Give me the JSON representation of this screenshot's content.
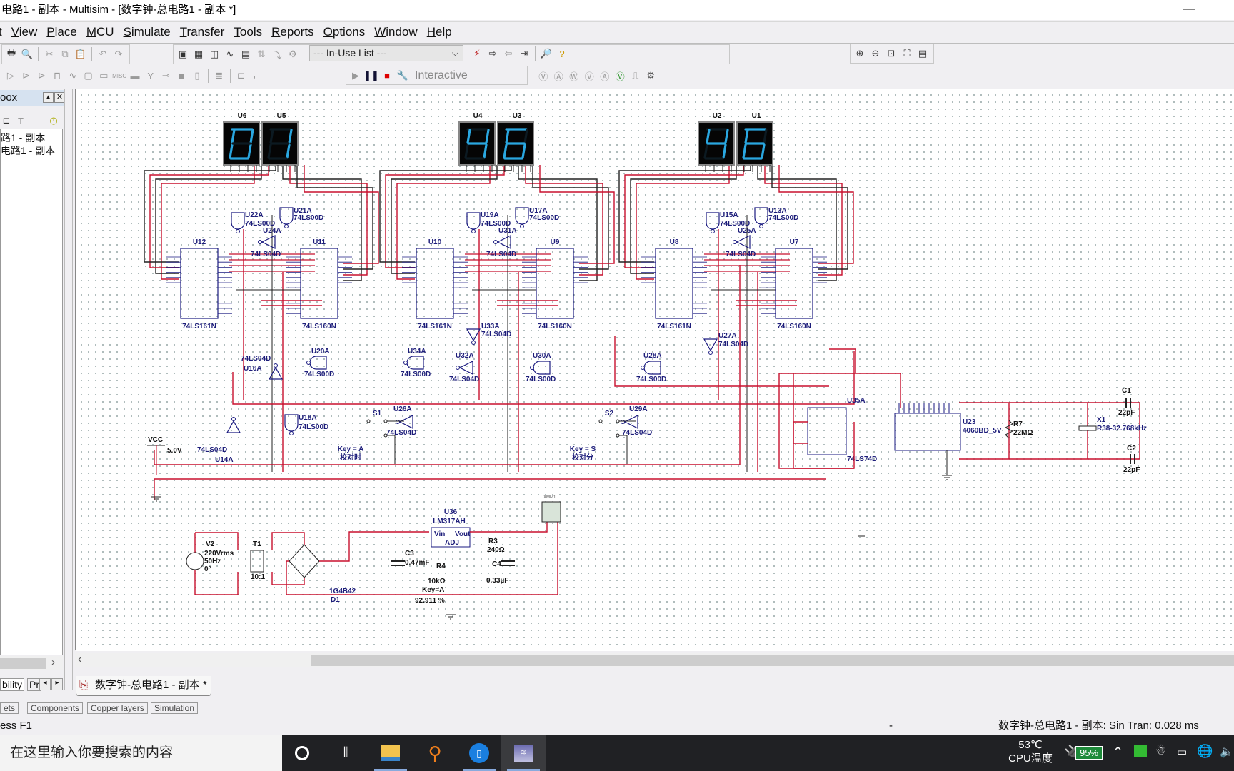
{
  "window": {
    "title": "电路1 - 副本 - Multisim - [数字钟-总电路1 - 副本 *]",
    "minimize": "—"
  },
  "menu": [
    {
      "label": "t",
      "u": ""
    },
    {
      "label": "View"
    },
    {
      "label": "Place"
    },
    {
      "label": "MCU"
    },
    {
      "label": "Simulate"
    },
    {
      "label": "Transfer"
    },
    {
      "label": "Tools"
    },
    {
      "label": "Reports"
    },
    {
      "label": "Options"
    },
    {
      "label": "Window"
    },
    {
      "label": "Help"
    }
  ],
  "toolbar": {
    "inuse_list": "--- In-Use List ---",
    "interactive_label": "Interactive",
    "zoom_icons": [
      "zoom-in",
      "zoom-out",
      "zoom-area",
      "zoom-fit",
      "full-screen"
    ],
    "instrument_icons": [
      "V",
      "A",
      "W",
      "±V",
      "AV",
      "−V",
      "Π",
      "⚙"
    ]
  },
  "sidebar": {
    "header": "oox",
    "tree": [
      "路1 - 副本",
      "电路1 - 副本"
    ],
    "tabs": [
      "bility",
      "Pr"
    ]
  },
  "schematic": {
    "displays": [
      {
        "ref": "U6",
        "digit": "0"
      },
      {
        "ref": "U5",
        "digit": "1"
      },
      {
        "ref": "U4",
        "digit": "4"
      },
      {
        "ref": "U3",
        "digit": "6"
      },
      {
        "ref": "U2",
        "digit": "4"
      },
      {
        "ref": "U1",
        "digit": "6"
      }
    ],
    "counters": [
      {
        "ref": "U12",
        "part": "74LS161N"
      },
      {
        "ref": "U11",
        "part": "74LS160N"
      },
      {
        "ref": "U10",
        "part": "74LS161N"
      },
      {
        "ref": "U9",
        "part": "74LS160N"
      },
      {
        "ref": "U8",
        "part": "74LS161N"
      },
      {
        "ref": "U7",
        "part": "74LS160N"
      }
    ],
    "gates": [
      {
        "ref": "U22A",
        "part": "74LS00D"
      },
      {
        "ref": "U21A",
        "part": "74LS00D"
      },
      {
        "ref": "U24A",
        "part": "74LS04D"
      },
      {
        "ref": "U19A",
        "part": "74LS00D"
      },
      {
        "ref": "U17A",
        "part": "74LS00D"
      },
      {
        "ref": "U31A",
        "part": "74LS04D"
      },
      {
        "ref": "U15A",
        "part": "74LS00D"
      },
      {
        "ref": "U13A",
        "part": "74LS00D"
      },
      {
        "ref": "U25A",
        "part": "74LS04D"
      },
      {
        "ref": "U20A",
        "part": "74LS00D"
      },
      {
        "ref": "U16A",
        "part": "74LS04D"
      },
      {
        "ref": "U18A",
        "part": "74LS00D"
      },
      {
        "ref": "U14A",
        "part": "74LS04D"
      },
      {
        "ref": "U26A",
        "part": "74LS04D"
      },
      {
        "ref": "U34A",
        "part": "74LS00D"
      },
      {
        "ref": "U32A",
        "part": "74LS04D"
      },
      {
        "ref": "U33A",
        "part": "74LS04D"
      },
      {
        "ref": "U30A",
        "part": "74LS00D"
      },
      {
        "ref": "U29A",
        "part": "74LS04D"
      },
      {
        "ref": "U28A",
        "part": "74LS00D"
      },
      {
        "ref": "U27A",
        "part": "74LS04D"
      }
    ],
    "switches": [
      {
        "ref": "S1",
        "key": "Key = A",
        "note": "校对时"
      },
      {
        "ref": "S2",
        "key": "Key = S",
        "note": "校对分"
      }
    ],
    "vcc": {
      "label": "VCC",
      "value": "5.0V"
    },
    "flipflop": {
      "ref": "U35A",
      "part": "74LS74D"
    },
    "oscillator": {
      "ref": "U23",
      "part": "4060BD_5V"
    },
    "r7": {
      "ref": "R7",
      "value": "22MΩ"
    },
    "x1": {
      "ref": "X1",
      "value": "R38-32.768kHz"
    },
    "c1": {
      "ref": "C1",
      "value": "22pF"
    },
    "c2": {
      "ref": "C2",
      "value": "22pF"
    },
    "v2": {
      "ref": "V2",
      "l1": "220Vrms",
      "l2": "50Hz",
      "l3": "0°"
    },
    "t1": {
      "ref": "T1",
      "ratio": "10:1"
    },
    "d1": {
      "ref": "D1",
      "part": "1G4B42"
    },
    "c3": {
      "ref": "C3",
      "value": "0.47mF"
    },
    "u36": {
      "ref": "U36",
      "part": "LM317AH",
      "vin": "Vin",
      "vout": "Vout",
      "adj": "ADJ"
    },
    "r3": {
      "ref": "R3",
      "value": "240Ω"
    },
    "r4": {
      "ref": "R4",
      "value": "10kΩ",
      "key": "Key=A",
      "percent": "92.911 %"
    },
    "c4": {
      "ref": "C4",
      "value": "0.33µF"
    },
    "xmm": {
      "ref": "XMM1"
    }
  },
  "doc_tab": "数字钟-总电路1 - 副本 *",
  "bottom_tabs": [
    "ets",
    "Components",
    "Copper layers",
    "Simulation"
  ],
  "status": {
    "left": "ess F1",
    "middle": "-",
    "right": "数字钟-总电路1 - 副本: Sin Tran: 0.028 ms"
  },
  "taskbar": {
    "search_placeholder": "在这里输入你要搜索的内容",
    "temp": "53℃",
    "temp_label": "CPU温度",
    "battery": "95%"
  }
}
